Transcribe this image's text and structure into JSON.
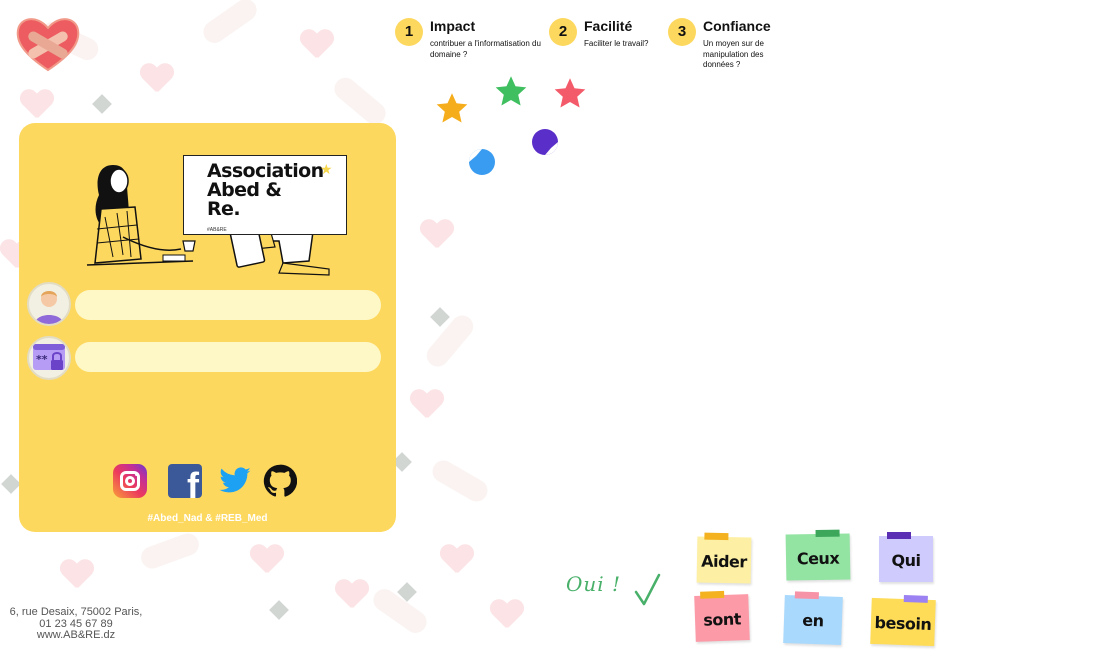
{
  "brand": {
    "sign_title": "Association\nAbed &\nRe.",
    "sign_subtitle": "#AB&RE"
  },
  "login": {
    "username_value": "",
    "password_value": ""
  },
  "socials": [
    "instagram-icon",
    "facebook-icon",
    "twitter-icon",
    "github-icon"
  ],
  "facebook_glyph": "f",
  "hashtag": "#Abed_Nad & #REB_Med",
  "footer": {
    "address": "6, rue Desaix, 75002 Paris,",
    "phone": "01 23 45 67 89",
    "website": "www.AB&RE.dz"
  },
  "steps": [
    {
      "number": "1",
      "title": "Impact",
      "description": "contribuer a l'informatisation du domaine ?"
    },
    {
      "number": "2",
      "title": "Facilité",
      "description": "Faciliter le travail?"
    },
    {
      "number": "3",
      "title": "Confiance",
      "description": "Un moyen sur de manipulation des données ?"
    }
  ],
  "handwriting": "Oui !",
  "notes": [
    "Aider",
    "Ceux",
    "Qui",
    "sont",
    "en",
    "besoin"
  ],
  "colors": {
    "card": "#fdd85e",
    "field": "#fef7c6",
    "step_circle": "#fdd85e",
    "oui_green": "#49b06a"
  }
}
